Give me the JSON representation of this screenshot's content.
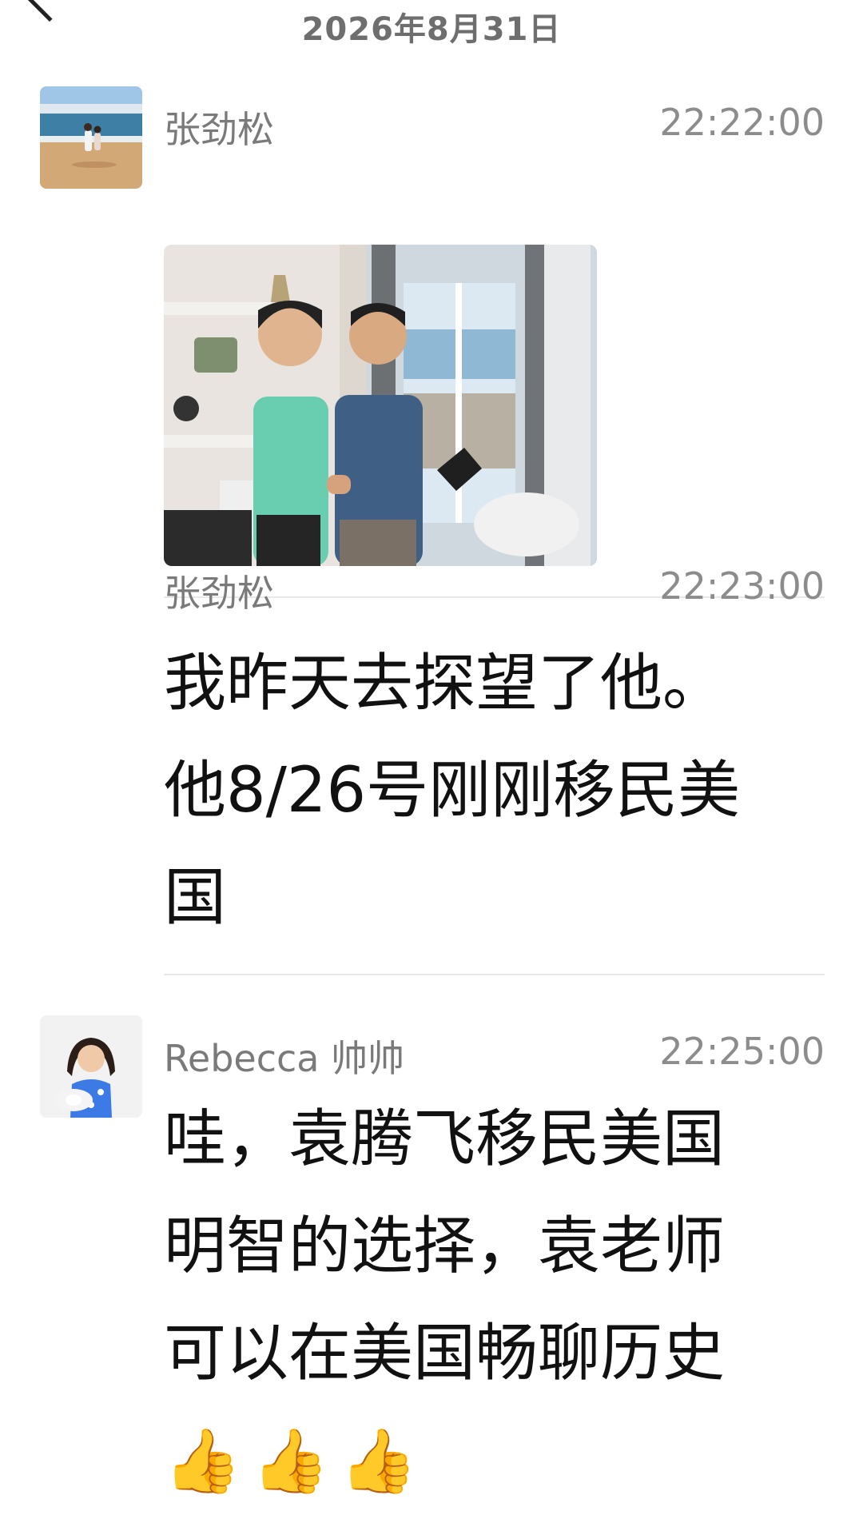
{
  "header": {
    "date": "2026年8月31日"
  },
  "messages": [
    {
      "sender": "张劲松",
      "time": "22:22:00",
      "type": "image"
    },
    {
      "sender": "张劲松",
      "time": "22:23:00",
      "type": "text",
      "text": "我昨天去探望了他。\n他8/26号刚刚移民美\n国"
    },
    {
      "sender": "Rebecca 帅帅",
      "time": "22:25:00",
      "type": "text",
      "text": "哇，袁腾飞移民美国\n明智的选择，袁老师\n可以在美国畅聊历史",
      "emoji": [
        "👍",
        "👍",
        "👍"
      ]
    }
  ],
  "icons": {
    "back": "chevron-left-icon",
    "thumbs": "thumbs-up-icon"
  },
  "colors": {
    "sender": "#7a7a7a",
    "time": "#8c8c8c",
    "text": "#111111",
    "divider": "#e8e8e8"
  }
}
